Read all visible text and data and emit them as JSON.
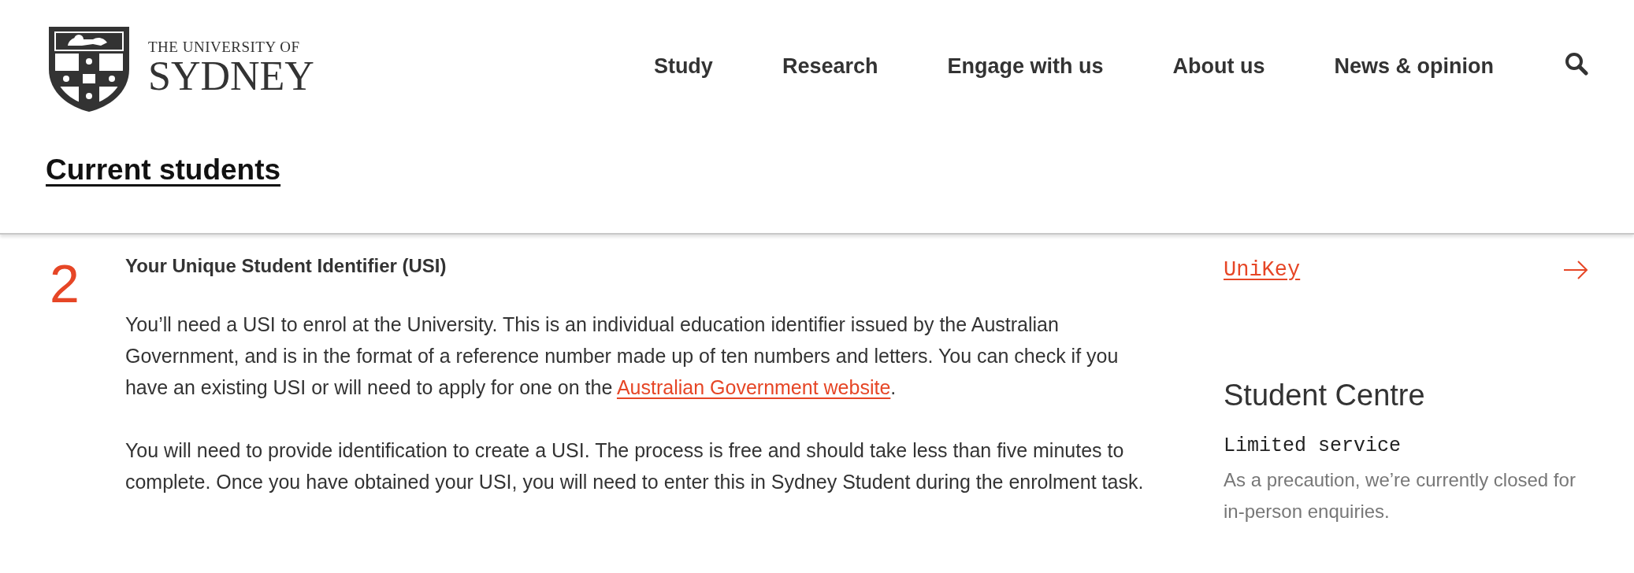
{
  "header": {
    "logo": {
      "line_1": "THE UNIVERSITY OF",
      "line_2": "SYDNEY"
    },
    "nav": [
      {
        "label": "Study"
      },
      {
        "label": "Research"
      },
      {
        "label": "Engage with us"
      },
      {
        "label": "About us"
      },
      {
        "label": "News & opinion"
      }
    ],
    "section_title": "Current students"
  },
  "step": {
    "number": "2",
    "heading": "Your Unique Student Identifier (USI)",
    "paragraphs": [
      {
        "before": "You’ll need a USI to enrol at the University. This is an individual education identifier issued by the Australian Government, and is in the format of a reference number made up of ten numbers and letters. You can check if you have an existing USI or will need to apply for one on the ",
        "link": "Australian Government website",
        "after": "."
      },
      {
        "before": "You will need to provide identification to create a USI. The process is free and should take less than five minutes to complete. Once you have obtained your USI, you will need to enter this in Sydney Student during the enrolment task."
      }
    ]
  },
  "sidebar": {
    "link": "UniKey",
    "contact": {
      "title": "Student Centre",
      "status": "Limited service",
      "note": "As a precaution, we’re currently closed for in-person enquiries."
    }
  }
}
